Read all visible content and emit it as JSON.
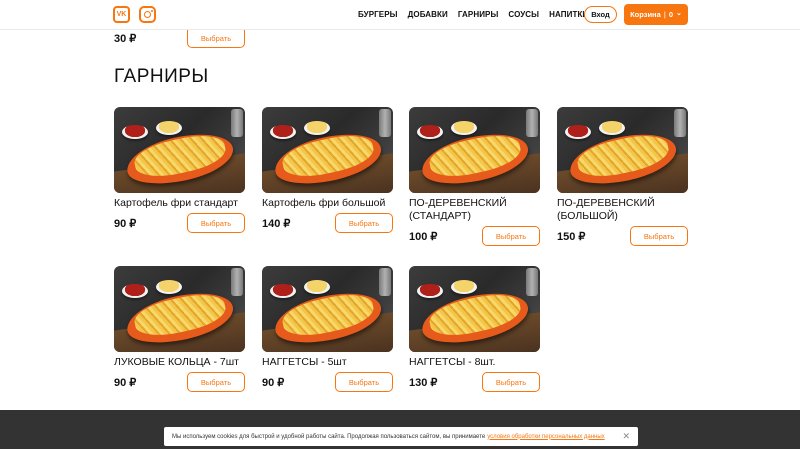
{
  "header": {
    "social": {
      "vk_label": "VK",
      "vk_icon": "vk-icon",
      "instagram_icon": "instagram-icon"
    },
    "nav": [
      "БУРГЕРЫ",
      "ДОБАВКИ",
      "ГАРНИРЫ",
      "СОУСЫ",
      "НАПИТКИ"
    ],
    "login_label": "Вход",
    "cart_label": "Корзина",
    "cart_separator": "|",
    "cart_count": "0",
    "cart_chevron": "⌄",
    "accent_color": "#f7760f"
  },
  "previous": {
    "price": "30 ₽",
    "button_label": "Выбрать"
  },
  "section": {
    "title": "ГАРНИРЫ",
    "items": [
      {
        "name": "Картофель фри стандарт",
        "price": "90 ₽",
        "button_label": "Выбрать"
      },
      {
        "name": "Картофель фри большой",
        "price": "140 ₽",
        "button_label": "Выбрать"
      },
      {
        "name": "ПО-ДЕРЕВЕНСКИЙ (СТАНДАРТ)",
        "price": "100 ₽",
        "button_label": "Выбрать"
      },
      {
        "name": "ПО-ДЕРЕВЕНСКИЙ (БОЛЬШОЙ)",
        "price": "150 ₽",
        "button_label": "Выбрать"
      },
      {
        "name": "ЛУКОВЫЕ КОЛЬЦА - 7шт",
        "price": "90 ₽",
        "button_label": "Выбрать"
      },
      {
        "name": "НАГГЕТСЫ - 5шт",
        "price": "90 ₽",
        "button_label": "Выбрать"
      },
      {
        "name": "НАГГЕТСЫ - 8шт.",
        "price": "130 ₽",
        "button_label": "Выбрать"
      }
    ]
  },
  "cookie": {
    "text": "Мы используем cookies для быстрой и удобной работы сайта. Продолжая пользоваться сайтом, вы принимаете",
    "link": "условия обработки персональных данных",
    "close": "✕"
  }
}
